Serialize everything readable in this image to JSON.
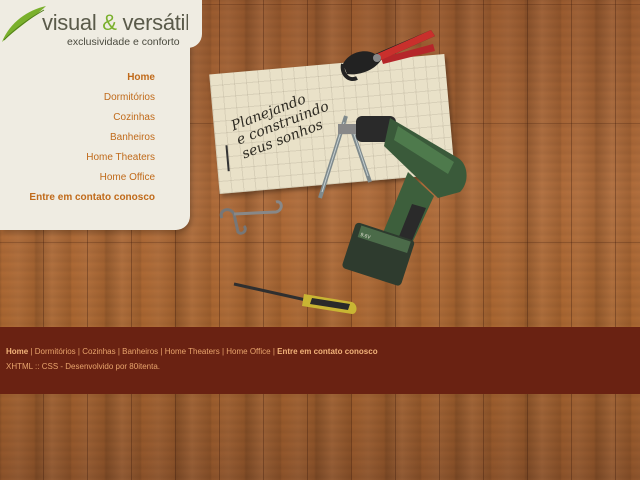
{
  "logo": {
    "brand_part1": "visual",
    "brand_amp": "&",
    "brand_part2": "versátil",
    "tagline": "exclusividade e conforto"
  },
  "menu": {
    "items": [
      {
        "label": "Home"
      },
      {
        "label": "Dormitórios"
      },
      {
        "label": "Cozinhas"
      },
      {
        "label": "Banheiros"
      },
      {
        "label": "Home Theaters"
      },
      {
        "label": "Home Office"
      },
      {
        "label": "Entre em contato conosco"
      }
    ]
  },
  "note": {
    "line1": "Planejando",
    "line2": "e construindo",
    "line3": "seus sonhos"
  },
  "footer": {
    "nav": [
      {
        "label": "Home"
      },
      {
        "label": "Dormitórios"
      },
      {
        "label": "Cozinhas"
      },
      {
        "label": "Banheiros"
      },
      {
        "label": "Home Theaters"
      },
      {
        "label": "Home Office"
      },
      {
        "label": "Entre em contato conosco"
      }
    ],
    "separator": "|",
    "credit": "XHTML :: CSS - Desenvolvido por 80itenta."
  },
  "drill_label": "9.6V",
  "colors": {
    "menu_link": "#c06a1a",
    "panel_bg": "#efece2",
    "footer_bg": "#6a2212",
    "footer_text": "#e8a46c",
    "logo_accent": "#7ab02c"
  }
}
